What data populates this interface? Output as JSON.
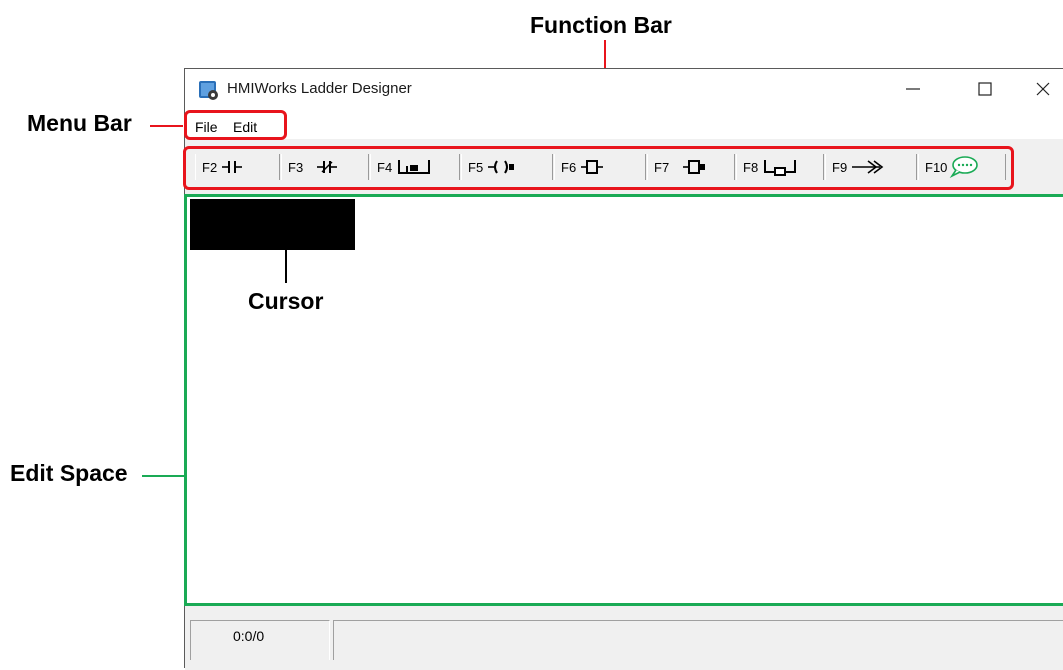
{
  "annotations": {
    "function_bar": "Function Bar",
    "menu_bar": "Menu Bar",
    "cursor": "Cursor",
    "edit_space": "Edit Space"
  },
  "window": {
    "title": "HMIWorks Ladder Designer",
    "icon": "app-icon",
    "controls": [
      "minimize-icon",
      "maximize-icon",
      "close-icon"
    ]
  },
  "menu": {
    "items": [
      "File",
      "Edit"
    ]
  },
  "toolbar": {
    "buttons": [
      {
        "key": "F2",
        "icon": "normally-open-contact-icon"
      },
      {
        "key": "F3",
        "icon": "normally-closed-contact-icon"
      },
      {
        "key": "F4",
        "icon": "parallel-branch-icon"
      },
      {
        "key": "F5",
        "icon": "coil-icon"
      },
      {
        "key": "F6",
        "icon": "function-block-icon"
      },
      {
        "key": "F7",
        "icon": "function-block-negated-icon"
      },
      {
        "key": "F8",
        "icon": "parallel-function-block-icon"
      },
      {
        "key": "F9",
        "icon": "jump-arrow-icon"
      },
      {
        "key": "F10",
        "icon": "comment-bubble-icon"
      }
    ]
  },
  "status": {
    "position": "0:0/0"
  },
  "colors": {
    "highlight_red": "#e8141c",
    "highlight_green": "#1aaa55",
    "comment_icon": "#1aaa55"
  }
}
